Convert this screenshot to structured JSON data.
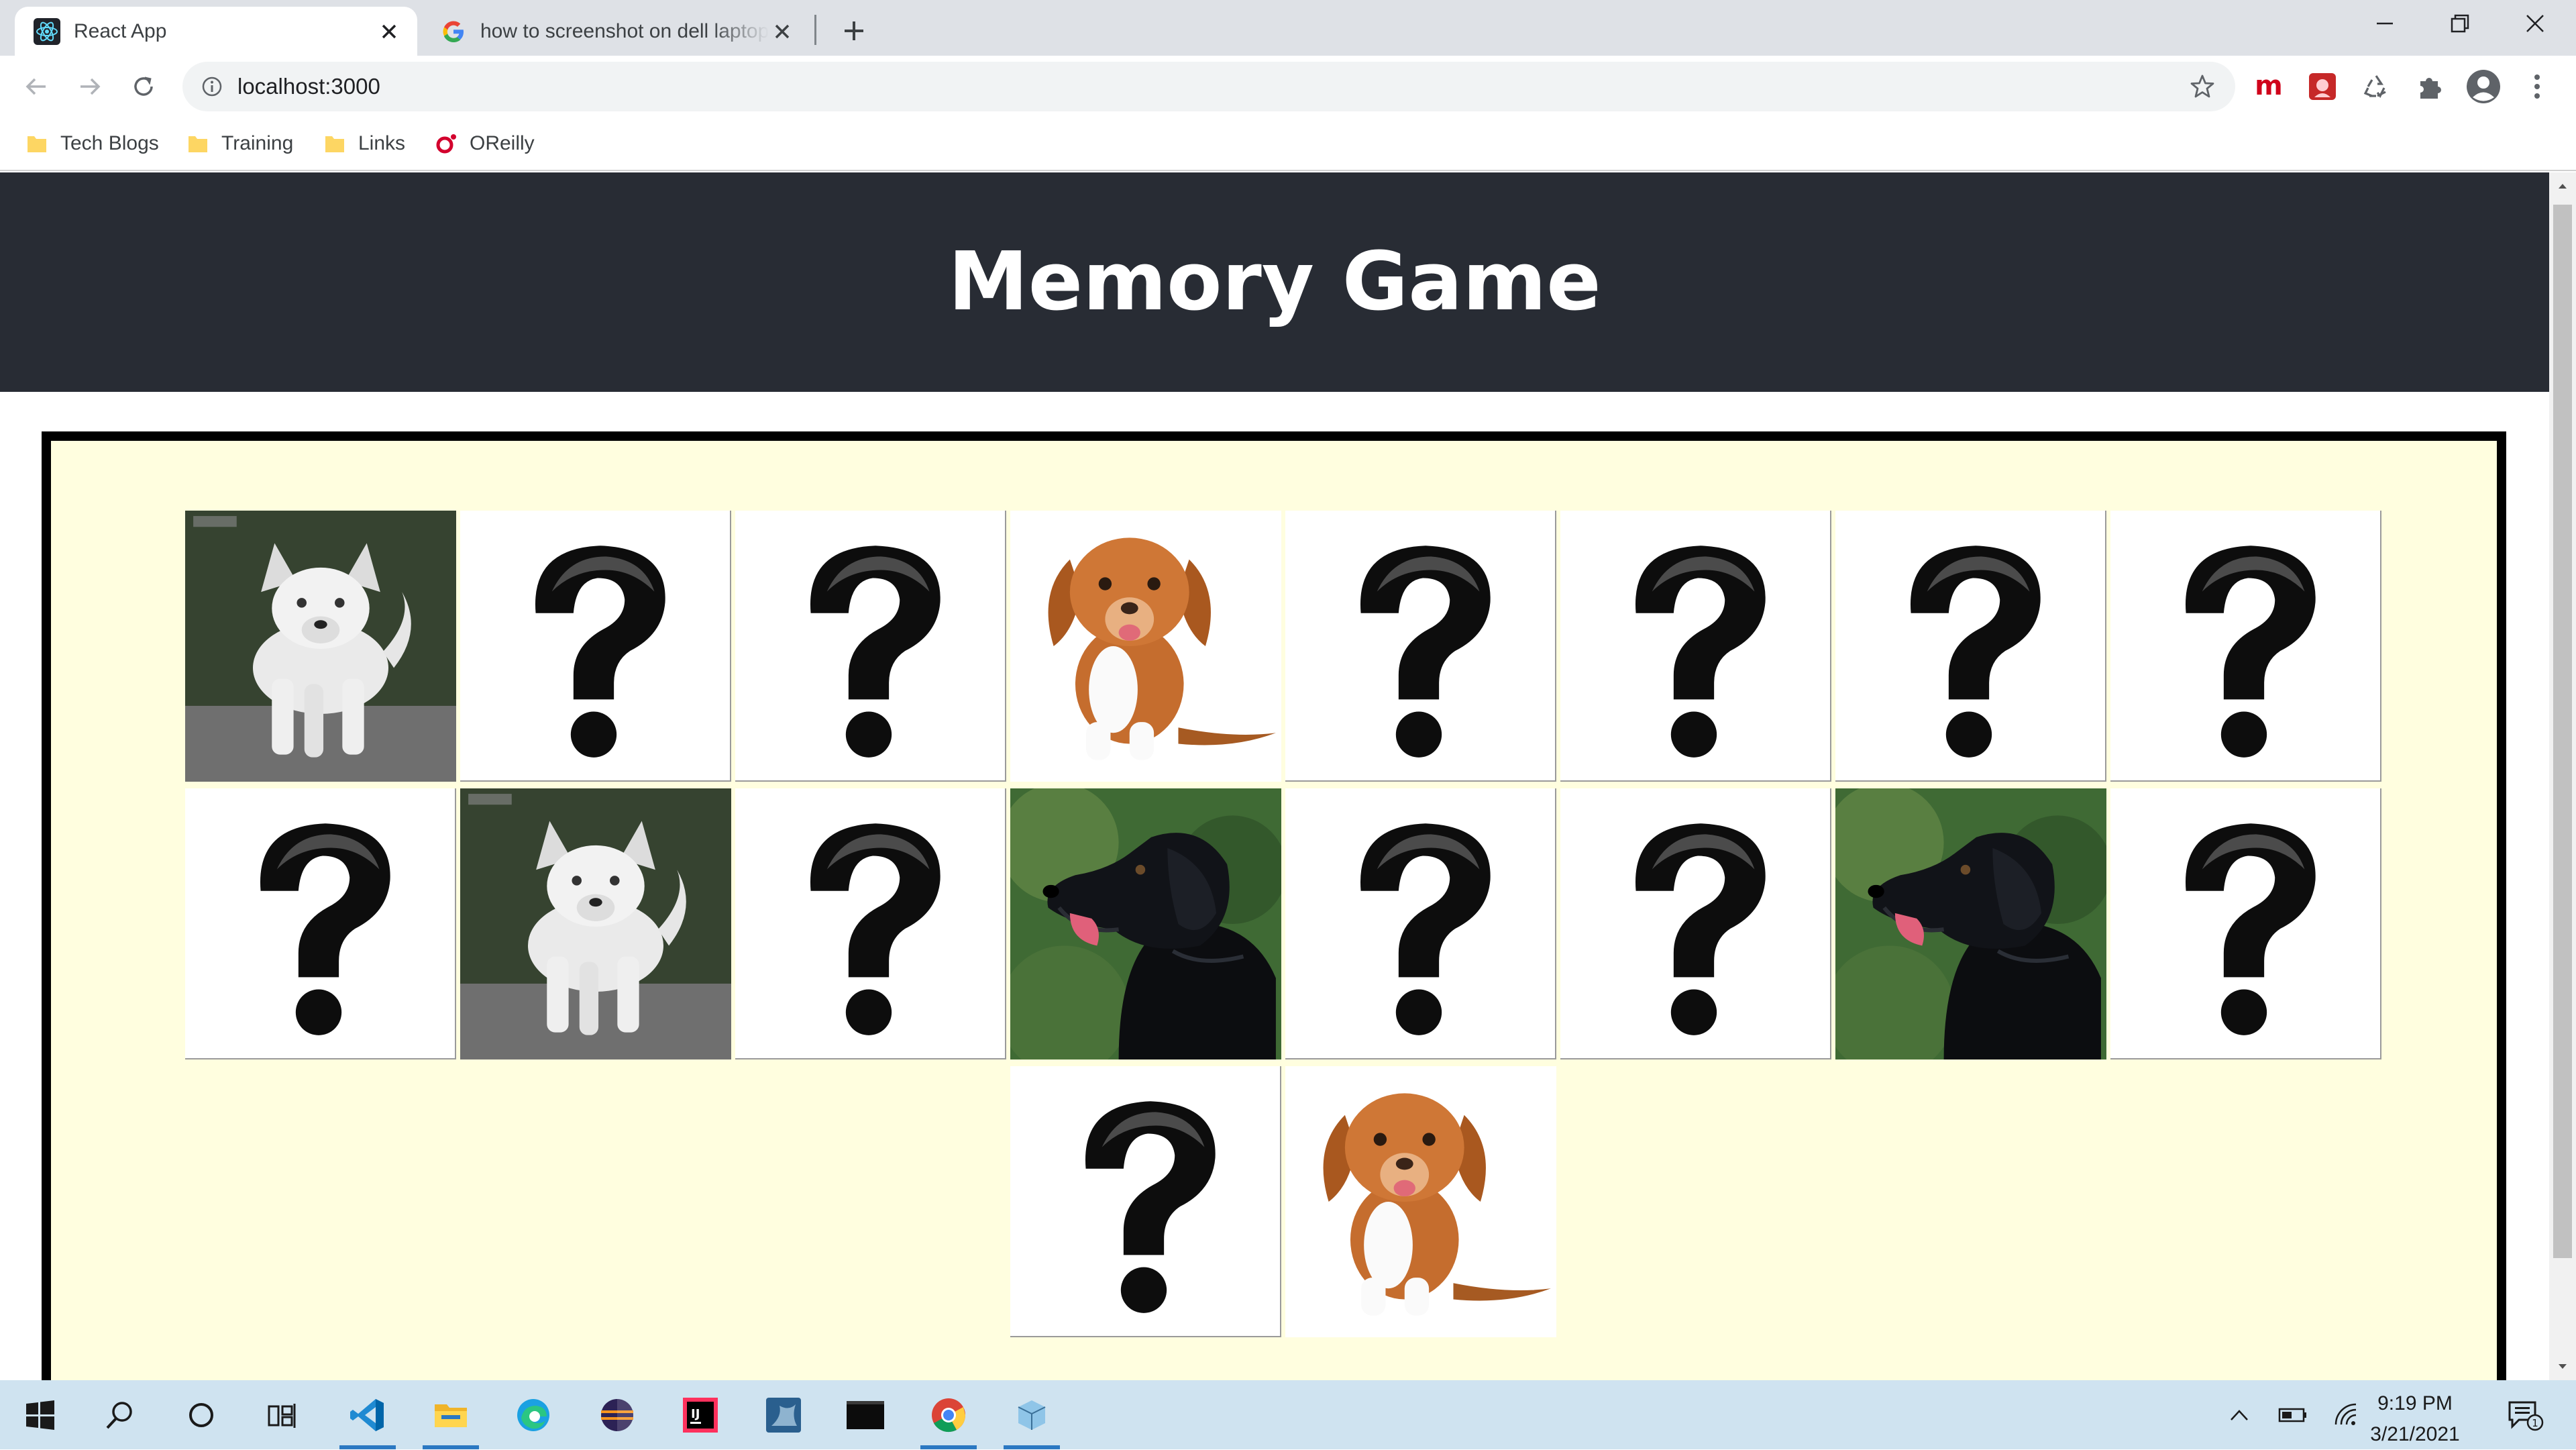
{
  "browser": {
    "tabs": [
      {
        "title": "React App",
        "icon": "react-icon",
        "active": true
      },
      {
        "title": "how to screenshot on dell laptop",
        "icon": "google-icon",
        "active": false
      }
    ],
    "address_bar": {
      "url": "localhost:3000"
    },
    "bookmarks": [
      {
        "label": "Tech Blogs",
        "icon": "folder-icon"
      },
      {
        "label": "Training",
        "icon": "folder-icon"
      },
      {
        "label": "Links",
        "icon": "folder-icon"
      },
      {
        "label": "OReilly",
        "icon": "oreilly-icon"
      }
    ],
    "extensions": [
      "m-extension-icon",
      "red-extension-icon",
      "recycle-extension-icon",
      "puzzle-icon",
      "profile-icon",
      "more-vert-icon"
    ],
    "accent_color": "#1a73e8"
  },
  "app": {
    "title": "Memory Game",
    "header_bg": "#282c34",
    "board_bg": "#fffedf",
    "cards": [
      {
        "face": "husky",
        "revealed": true
      },
      {
        "face": "hidden",
        "revealed": false
      },
      {
        "face": "hidden",
        "revealed": false
      },
      {
        "face": "toller-puppy",
        "revealed": true
      },
      {
        "face": "hidden",
        "revealed": false
      },
      {
        "face": "hidden",
        "revealed": false
      },
      {
        "face": "hidden",
        "revealed": false
      },
      {
        "face": "hidden",
        "revealed": false
      },
      {
        "face": "hidden",
        "revealed": false
      },
      {
        "face": "husky",
        "revealed": true
      },
      {
        "face": "hidden",
        "revealed": false
      },
      {
        "face": "black-labrador",
        "revealed": true
      },
      {
        "face": "hidden",
        "revealed": false
      },
      {
        "face": "hidden",
        "revealed": false
      },
      {
        "face": "black-labrador",
        "revealed": true
      },
      {
        "face": "hidden",
        "revealed": false
      },
      {
        "face": "hidden",
        "revealed": false
      },
      {
        "face": "toller-puppy",
        "revealed": true
      }
    ]
  },
  "taskbar": {
    "apps": [
      "start-icon",
      "search-icon",
      "cortana-icon",
      "task-view-icon",
      "vscode-icon",
      "file-explorer-icon",
      "edge-icon",
      "eclipse-icon",
      "intellij-icon",
      "mysql-workbench-icon",
      "terminal-icon",
      "chrome-icon",
      "virtualbox-icon"
    ],
    "time": "9:19 PM",
    "date": "3/21/2021",
    "notification_count": "1"
  }
}
